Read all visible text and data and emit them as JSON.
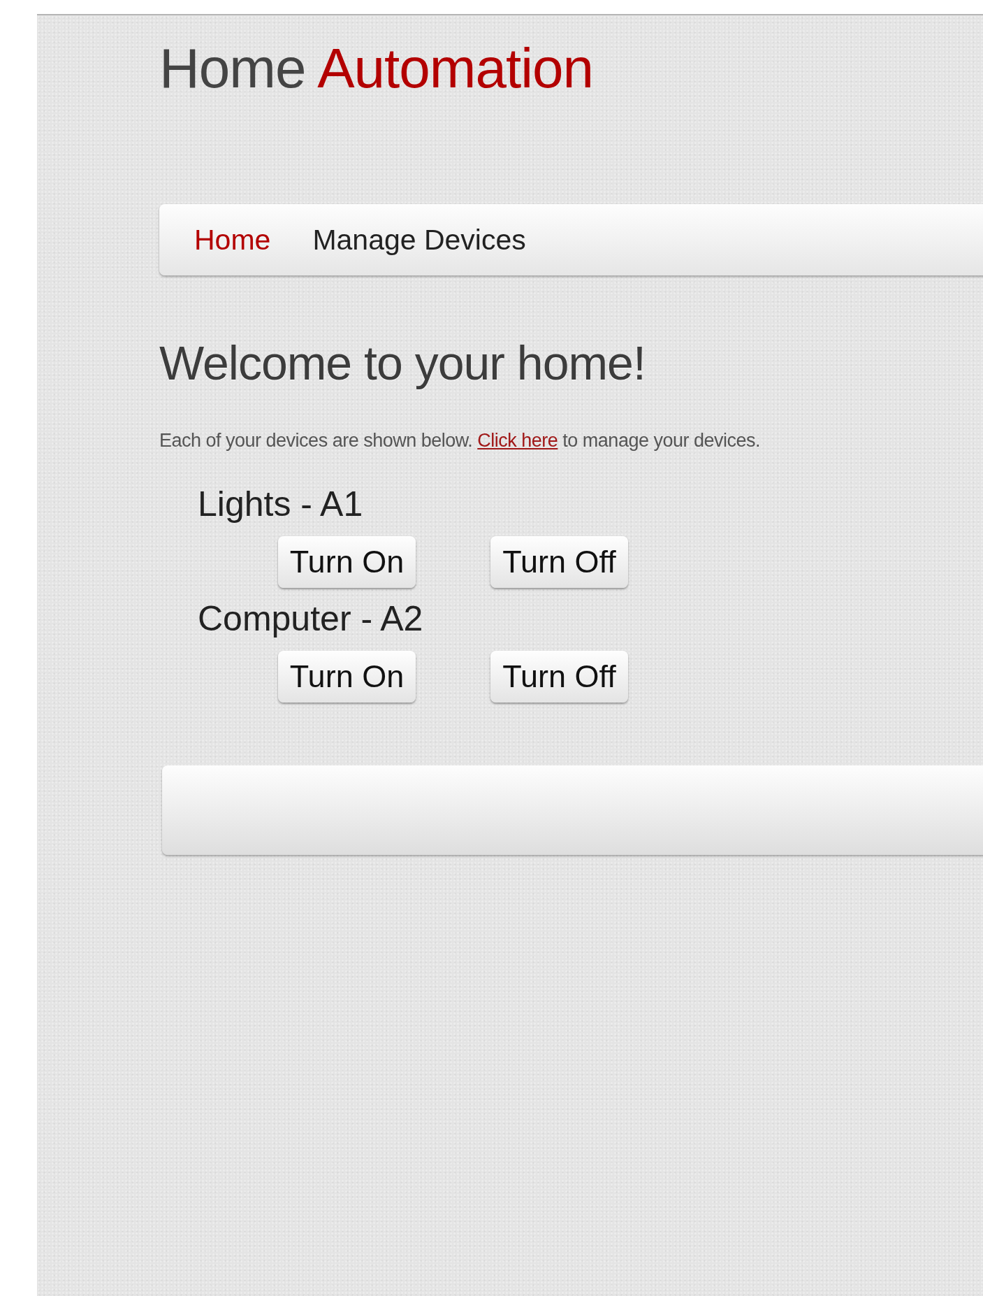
{
  "site_title": {
    "text": "Home",
    "highlight": "Automation"
  },
  "nav": [
    {
      "label": "Home",
      "selected": true
    },
    {
      "label": "Manage Devices",
      "selected": false
    }
  ],
  "heading": "Welcome to your home!",
  "intro": {
    "before": "Each of your devices are shown below.",
    "link": "Click here",
    "after": "to manage your devices."
  },
  "devices": [
    {
      "name": "Lights - A1",
      "buttons": [
        "Turn On",
        "Turn Off"
      ]
    },
    {
      "name": "Computer - A2",
      "buttons": [
        "Turn On",
        "Turn Off"
      ]
    }
  ]
}
